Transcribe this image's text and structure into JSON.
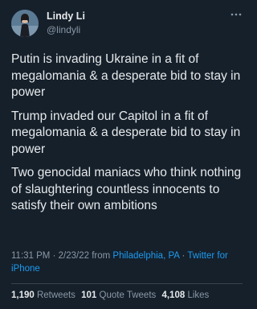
{
  "author": {
    "display_name": "Lindy Li",
    "handle": "@lindyli"
  },
  "tweet": {
    "paragraphs": [
      "Putin is invading Ukraine in a fit of megalomania & a desperate bid to stay in power",
      "Trump invaded our Capitol in a fit of megalomania & a desperate bid to stay in power",
      "Two genocidal maniacs who think nothing of slaughtering countless innocents to satisfy their own ambitions"
    ],
    "time": "11:31 PM",
    "date": "2/23/22",
    "from_word": "from",
    "location": "Philadelphia, PA",
    "separator": "·",
    "client": "Twitter for iPhone"
  },
  "stats": {
    "retweets_count": "1,190",
    "retweets_label": "Retweets",
    "quotes_count": "101",
    "quotes_label": "Quote Tweets",
    "likes_count": "4,108",
    "likes_label": "Likes"
  },
  "icons": {
    "more": "more-dots-icon"
  },
  "colors": {
    "background": "#15202b",
    "text": "#e7e9ea",
    "secondary": "#8b98a5",
    "link": "#1d9bf0",
    "divider": "#38444d"
  }
}
